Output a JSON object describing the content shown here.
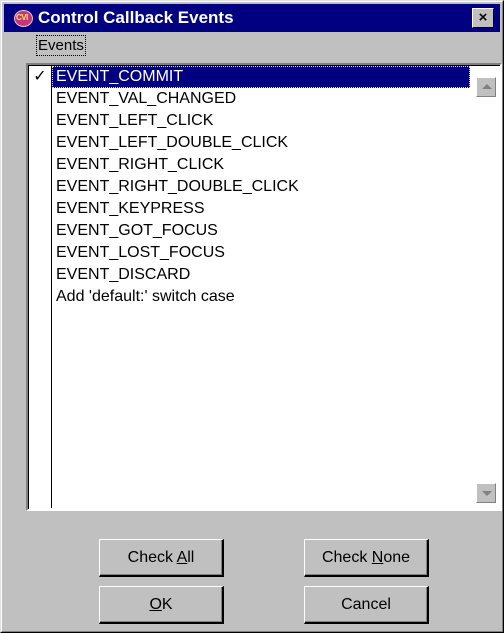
{
  "window": {
    "title": "Control Callback Events",
    "app_icon": "cvi-icon",
    "close_label": "×"
  },
  "events_label": "Events",
  "events": [
    {
      "label": "EVENT_COMMIT",
      "checked": true,
      "selected": true
    },
    {
      "label": "EVENT_VAL_CHANGED",
      "checked": false
    },
    {
      "label": "EVENT_LEFT_CLICK",
      "checked": false
    },
    {
      "label": "EVENT_LEFT_DOUBLE_CLICK",
      "checked": false
    },
    {
      "label": "EVENT_RIGHT_CLICK",
      "checked": false
    },
    {
      "label": "EVENT_RIGHT_DOUBLE_CLICK",
      "checked": false
    },
    {
      "label": "EVENT_KEYPRESS",
      "checked": false
    },
    {
      "label": "EVENT_GOT_FOCUS",
      "checked": false
    },
    {
      "label": "EVENT_LOST_FOCUS",
      "checked": false
    },
    {
      "label": "EVENT_DISCARD",
      "checked": false
    },
    {
      "label": "Add 'default:' switch case",
      "checked": false
    }
  ],
  "check_mark": "✓",
  "buttons": {
    "check_all": {
      "pre": "Check ",
      "mnemonic": "A",
      "post": "ll"
    },
    "check_none": {
      "pre": "Check ",
      "mnemonic": "N",
      "post": "one"
    },
    "ok": {
      "pre": "",
      "mnemonic": "O",
      "post": "K"
    },
    "cancel": {
      "pre": "Cancel",
      "mnemonic": "",
      "post": ""
    }
  },
  "colors": {
    "selection": "#000080",
    "title_bar": "#000080",
    "face": "#c0c0c0"
  }
}
